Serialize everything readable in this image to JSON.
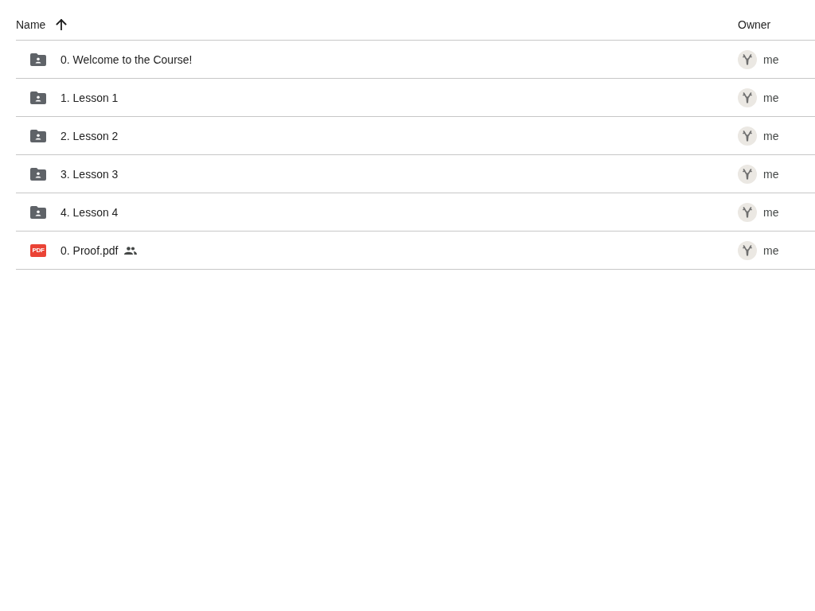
{
  "table": {
    "columns": [
      {
        "label": "Name",
        "sorted": true,
        "descending": false
      },
      {
        "label": "Owner",
        "sorted": false
      }
    ],
    "rows": [
      {
        "kind": "shared-folder",
        "name": "0. Welcome to the Course!",
        "shared": false,
        "owner": "me"
      },
      {
        "kind": "shared-folder",
        "name": "1. Lesson 1",
        "shared": false,
        "owner": "me"
      },
      {
        "kind": "shared-folder",
        "name": "2. Lesson 2",
        "shared": false,
        "owner": "me"
      },
      {
        "kind": "shared-folder",
        "name": "3. Lesson 3",
        "shared": false,
        "owner": "me"
      },
      {
        "kind": "shared-folder",
        "name": "4. Lesson 4",
        "shared": false,
        "owner": "me"
      },
      {
        "kind": "pdf",
        "icon_text": "PDF",
        "name": "0. Proof.pdf",
        "shared": true,
        "owner": "me"
      }
    ]
  }
}
